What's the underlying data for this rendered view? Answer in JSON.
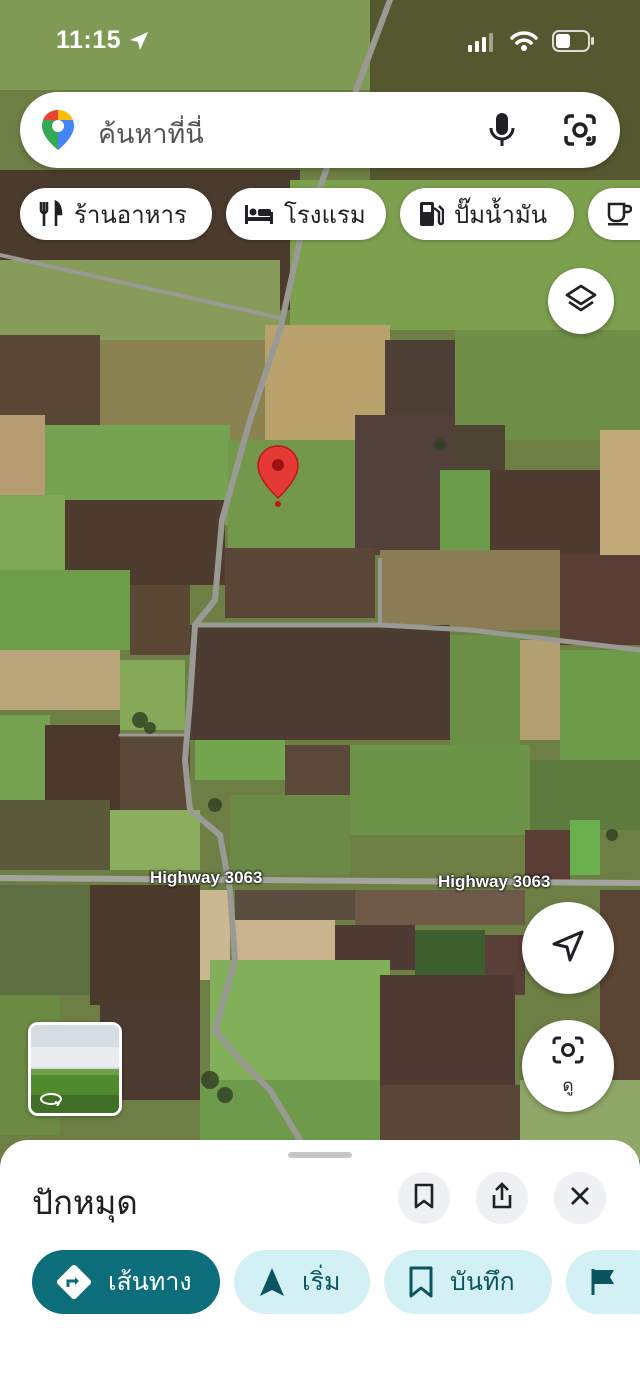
{
  "status_bar": {
    "time": "11:15",
    "icons": [
      "location-arrow-icon",
      "signal-icon",
      "wifi-icon",
      "battery-icon"
    ]
  },
  "search": {
    "placeholder": "ค้นหาที่นี่",
    "icons": [
      "google-maps-pin-icon",
      "microphone-icon",
      "google-lens-icon"
    ]
  },
  "categories": [
    {
      "label": "ร้านอาหาร",
      "icon": "restaurant-icon"
    },
    {
      "label": "โรงแรม",
      "icon": "hotel-icon"
    },
    {
      "label": "ปั๊มน้ำมัน",
      "icon": "gas-station-icon"
    },
    {
      "label": "",
      "icon": "coffee-icon"
    }
  ],
  "map": {
    "road_labels": [
      "Highway 3063",
      "Highway 3063"
    ],
    "controls": {
      "layers": "layers-icon",
      "my_location": "navigation-arrow-icon",
      "look": "ดู"
    }
  },
  "sheet": {
    "title": "ปักหมุด",
    "actions": [
      {
        "label": "เส้นทาง",
        "icon": "directions-icon"
      },
      {
        "label": "เริ่ม",
        "icon": "start-navigation-icon"
      },
      {
        "label": "บันทึก",
        "icon": "bookmark-icon"
      },
      {
        "label": "",
        "icon": "flag-icon"
      }
    ]
  },
  "colors": {
    "accent": "#0b6e7a",
    "chip_bg": "#d3f0f5",
    "pin": "#e53935"
  }
}
